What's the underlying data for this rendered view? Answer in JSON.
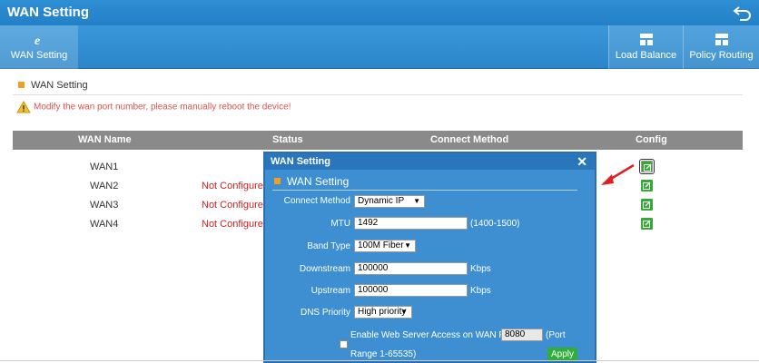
{
  "header": {
    "title": "WAN Setting"
  },
  "nav": {
    "tabs": [
      {
        "label": "WAN Setting"
      },
      {
        "label": "Load Balance"
      },
      {
        "label": "Policy Routing"
      }
    ]
  },
  "section": {
    "title": "WAN Setting",
    "warning": "Modify the wan port number, please manually reboot the device!"
  },
  "table": {
    "headers": [
      "WAN Name",
      "Status",
      "Connect Method",
      "Config"
    ],
    "rows": [
      {
        "name": "WAN1",
        "status": ""
      },
      {
        "name": "WAN2",
        "status": "Not Configure"
      },
      {
        "name": "WAN3",
        "status": "Not Configure"
      },
      {
        "name": "WAN4",
        "status": "Not Configure"
      }
    ]
  },
  "dialog": {
    "title": "WAN Setting",
    "section": "WAN Setting",
    "connect_method": {
      "label": "Connect Method",
      "value": "Dynamic IP"
    },
    "mtu": {
      "label": "MTU",
      "value": "1492",
      "hint": "(1400-1500)"
    },
    "band_type": {
      "label": "Band Type",
      "value": "100M Fiber"
    },
    "downstream": {
      "label": "Downstream",
      "value": "100000",
      "unit": "Kbps"
    },
    "upstream": {
      "label": "Upstream",
      "value": "100000",
      "unit": "Kbps"
    },
    "dns_priority": {
      "label": "DNS Priority",
      "value": "High priority"
    },
    "web_access": {
      "label": "Enable Web Server Access on WAN Port",
      "port": "8080",
      "range_a": "(Port",
      "range_b": "Range 1-65535)",
      "checked": false
    },
    "apply_label": "Apply"
  },
  "colors": {
    "brand": "#2f8fd4",
    "warning": "#d9534f",
    "config_icon": "#33aa33",
    "apply": "#2fae3a"
  }
}
